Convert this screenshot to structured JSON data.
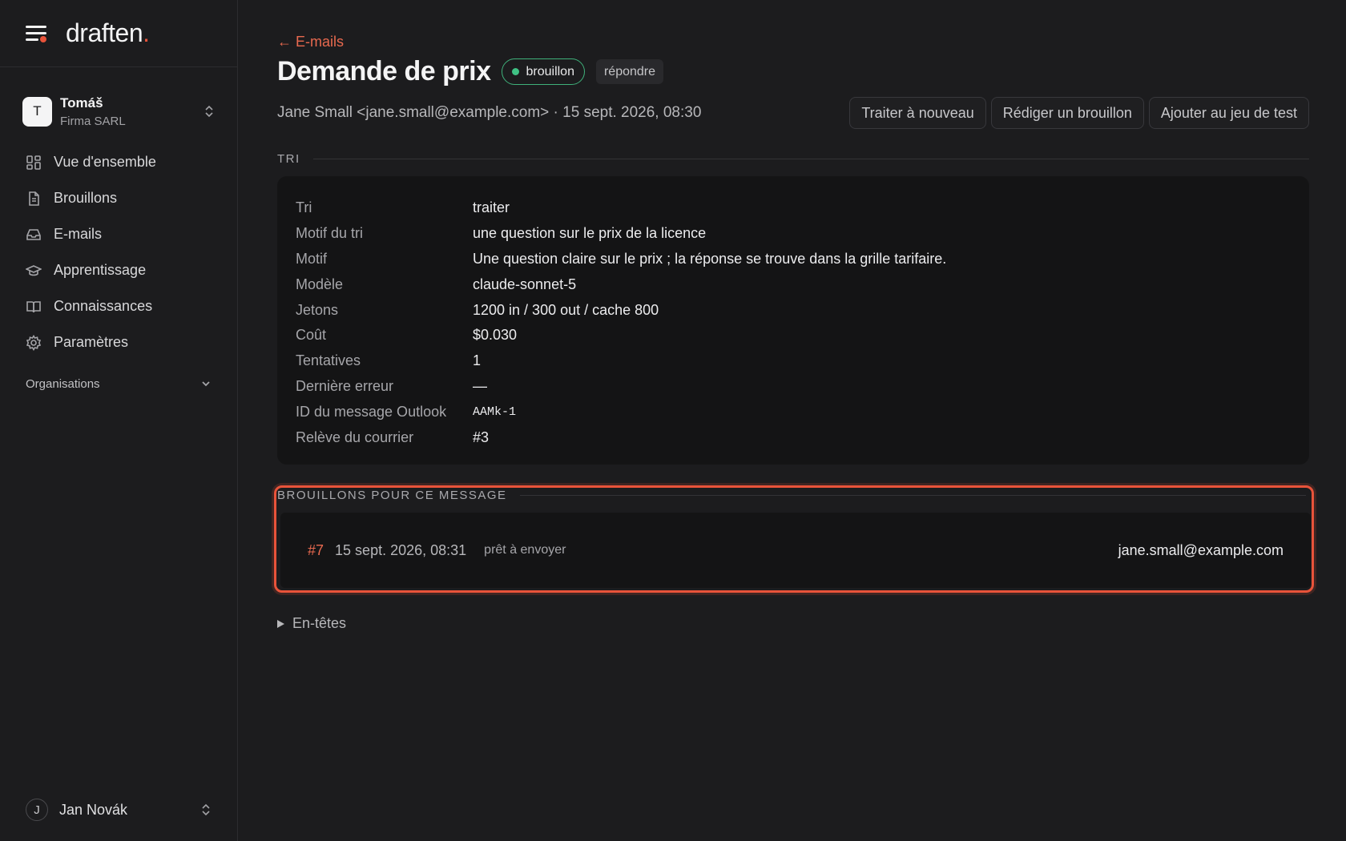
{
  "app": {
    "brand_name": "draften",
    "brand_dot": "."
  },
  "org": {
    "avatar_letter": "T",
    "name": "Tomáš",
    "subtitle": "Firma SARL"
  },
  "nav": {
    "items": [
      {
        "label": "Vue d'ensemble",
        "icon": "grid-icon"
      },
      {
        "label": "Brouillons",
        "icon": "document-icon"
      },
      {
        "label": "E-mails",
        "icon": "inbox-icon"
      },
      {
        "label": "Apprentissage",
        "icon": "graduation-cap-icon"
      },
      {
        "label": "Connaissances",
        "icon": "book-icon"
      },
      {
        "label": "Paramètres",
        "icon": "gear-icon"
      }
    ],
    "section_label": "Organisations"
  },
  "user": {
    "avatar_letter": "J",
    "name": "Jan Novák"
  },
  "header": {
    "back_label": "← E-mails",
    "title": "Demande de prix",
    "status_badge": "brouillon",
    "type_badge": "répondre",
    "meta": "Jane Small <jane.small@example.com> · 15 sept. 2026, 08:30",
    "actions": {
      "reprocess": "Traiter à nouveau",
      "draft": "Rédiger un brouillon",
      "add_test": "Ajouter au jeu de test"
    }
  },
  "triage": {
    "section_title": "TRI",
    "rows": [
      {
        "label": "Tri",
        "value": "traiter"
      },
      {
        "label": "Motif du tri",
        "value": "une question sur le prix de la licence"
      },
      {
        "label": "Motif",
        "value": "Une question claire sur le prix ; la réponse se trouve dans la grille tarifaire."
      },
      {
        "label": "Modèle",
        "value": "claude-sonnet-5"
      },
      {
        "label": "Jetons",
        "value": "1200 in / 300 out / cache 800"
      },
      {
        "label": "Coût",
        "value": "$0.030"
      },
      {
        "label": "Tentatives",
        "value": "1"
      },
      {
        "label": "Dernière erreur",
        "value": "—"
      },
      {
        "label": "ID du message Outlook",
        "value": "AAMk-1"
      },
      {
        "label": "Relève du courrier",
        "value": "#3"
      }
    ]
  },
  "drafts": {
    "section_title": "BROUILLONS POUR CE MESSAGE",
    "items": [
      {
        "id": "#7",
        "date": "15 sept. 2026, 08:31",
        "status": "prêt à envoyer",
        "to": "jane.small@example.com"
      }
    ]
  },
  "headers_toggle": "En-têtes",
  "colors": {
    "accent": "#e8533a",
    "success": "#3fc184",
    "background": "#1c1c1e",
    "card": "#141415"
  }
}
